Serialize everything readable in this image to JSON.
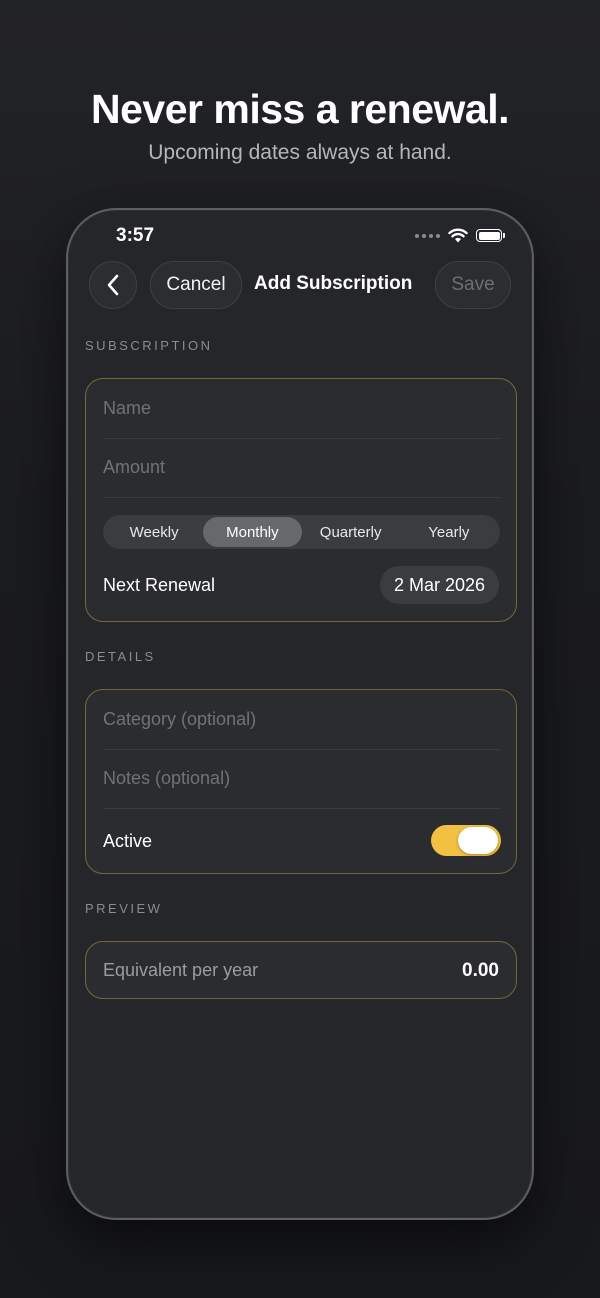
{
  "promo": {
    "headline": "Never miss a renewal.",
    "subheadline": "Upcoming dates always at hand."
  },
  "status_bar": {
    "time": "3:57",
    "icons": [
      "signal-dots-icon",
      "wifi-icon",
      "battery-icon"
    ]
  },
  "nav": {
    "back_icon": "chevron-left-icon",
    "cancel_label": "Cancel",
    "title": "Add Subscription",
    "save_label": "Save"
  },
  "subscription_section": {
    "label": "SUBSCRIPTION",
    "name_placeholder": "Name",
    "amount_placeholder": "Amount",
    "frequency_options": [
      "Weekly",
      "Monthly",
      "Quarterly",
      "Yearly"
    ],
    "selected_frequency": "Monthly",
    "next_renewal_label": "Next Renewal",
    "next_renewal_value": "2 Mar 2026"
  },
  "details_section": {
    "label": "DETAILS",
    "category_placeholder": "Category (optional)",
    "notes_placeholder": "Notes (optional)",
    "active_label": "Active",
    "active_on": true
  },
  "preview_section": {
    "label": "PREVIEW",
    "equivalent_label": "Equivalent per year",
    "equivalent_value": "0.00"
  },
  "colors": {
    "accent": "#f2c043",
    "card_border": "#74673f",
    "background": "#1b1c20",
    "card_fill": "#2a2c30"
  }
}
